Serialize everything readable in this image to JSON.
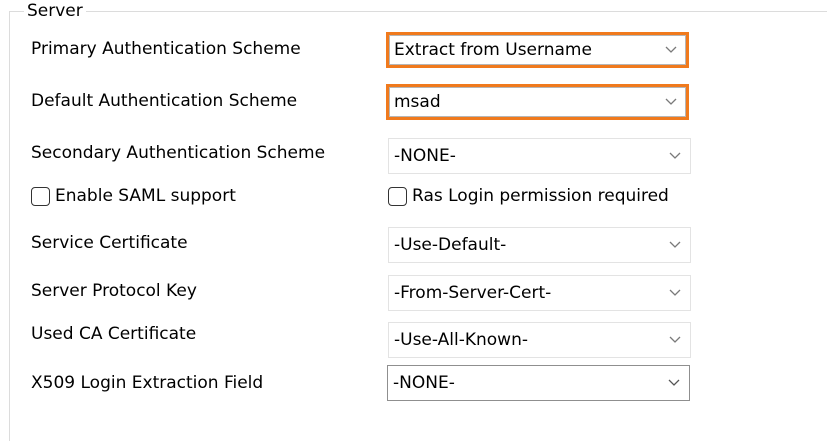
{
  "group": {
    "title": "Server"
  },
  "rows": {
    "primary_auth": {
      "label": "Primary Authentication Scheme",
      "value": "Extract from Username"
    },
    "default_auth": {
      "label": "Default Authentication Scheme",
      "value": "msad"
    },
    "secondary_auth": {
      "label": "Secondary Authentication Scheme",
      "value": "-NONE-"
    },
    "service_cert": {
      "label": "Service Certificate",
      "value": "-Use-Default-"
    },
    "server_protocol_key": {
      "label": "Server Protocol Key",
      "value": "-From-Server-Cert-"
    },
    "used_ca_cert": {
      "label": "Used CA Certificate",
      "value": "-Use-All-Known-"
    },
    "x509_login_field": {
      "label": "X509 Login Extraction Field",
      "value": "-NONE-"
    }
  },
  "checkboxes": {
    "enable_saml": {
      "label": "Enable SAML support",
      "checked": false
    },
    "ras_login": {
      "label": "Ras Login permission required",
      "checked": false
    }
  },
  "colors": {
    "highlight_border": "#f07a1d",
    "group_border": "#dcdcdc",
    "combo_border": "#8f8f8f",
    "arrow": "#7a7a7a"
  },
  "icons": {
    "dropdown": "chevron-down-icon"
  }
}
